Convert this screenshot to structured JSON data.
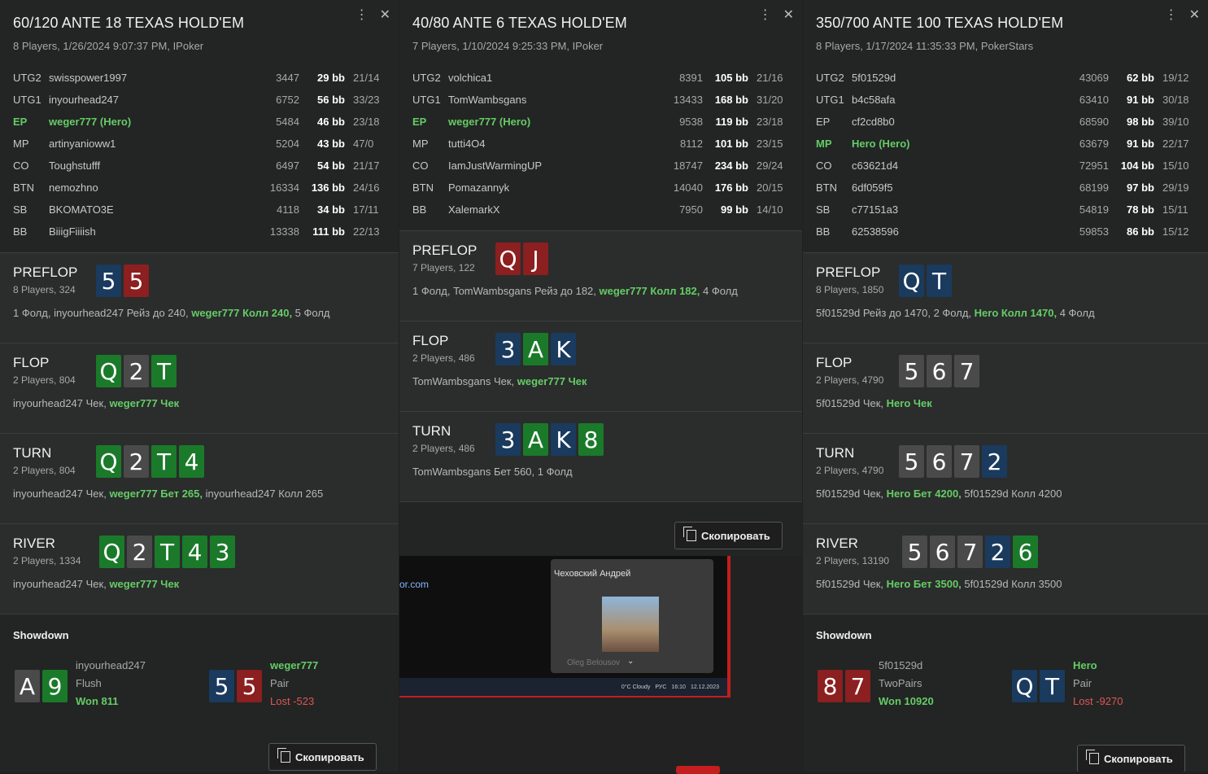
{
  "panels": [
    {
      "title": "60/120 ANTE 18 TEXAS HOLD'EM",
      "subtitle": "8 Players, 1/26/2024 9:07:37 PM, IPoker",
      "players": [
        {
          "pos": "UTG2",
          "name": "swisspower1997",
          "stack": "3447",
          "bb": "29 bb",
          "ratio": "21/14"
        },
        {
          "pos": "UTG1",
          "name": "inyourhead247",
          "stack": "6752",
          "bb": "56 bb",
          "ratio": "33/23"
        },
        {
          "pos": "EP",
          "name": "weger777 (Hero)",
          "stack": "5484",
          "bb": "46 bb",
          "ratio": "23/18",
          "hero": true
        },
        {
          "pos": "MP",
          "name": "artinyanioww1",
          "stack": "5204",
          "bb": "43 bb",
          "ratio": "47/0"
        },
        {
          "pos": "CO",
          "name": "Toughstufff",
          "stack": "6497",
          "bb": "54 bb",
          "ratio": "21/17"
        },
        {
          "pos": "BTN",
          "name": "nemozhno",
          "stack": "16334",
          "bb": "136 bb",
          "ratio": "24/16"
        },
        {
          "pos": "SB",
          "name": "BKOMATO3E",
          "stack": "4118",
          "bb": "34 bb",
          "ratio": "17/11"
        },
        {
          "pos": "BB",
          "name": "BiiigFiiiish",
          "stack": "13338",
          "bb": "111 bb",
          "ratio": "22/13"
        }
      ],
      "streets": [
        {
          "name": "PREFLOP",
          "info": "8 Players, 324",
          "cards": [
            {
              "r": "5",
              "c": "blue"
            },
            {
              "r": "5",
              "c": "red"
            }
          ],
          "pre": "1 Фолд, inyourhead247 Рейз до 240, ",
          "hero": "weger777 Колл 240,",
          "post": " 5 Фолд"
        },
        {
          "name": "FLOP",
          "info": "2 Players, 804",
          "cards": [
            {
              "r": "Q",
              "c": "green"
            },
            {
              "r": "2",
              "c": "grey"
            },
            {
              "r": "T",
              "c": "green"
            }
          ],
          "pre": "inyourhead247 Чек, ",
          "hero": "weger777 Чек",
          "post": ""
        },
        {
          "name": "TURN",
          "info": "2 Players, 804",
          "cards": [
            {
              "r": "Q",
              "c": "green"
            },
            {
              "r": "2",
              "c": "grey"
            },
            {
              "r": "T",
              "c": "green"
            },
            {
              "r": "4",
              "c": "green"
            }
          ],
          "pre": "inyourhead247 Чек, ",
          "hero": "weger777 Бет 265,",
          "post": " inyourhead247 Колл 265"
        },
        {
          "name": "RIVER",
          "info": "2 Players, 1334",
          "cards": [
            {
              "r": "Q",
              "c": "green"
            },
            {
              "r": "2",
              "c": "grey"
            },
            {
              "r": "T",
              "c": "green"
            },
            {
              "r": "4",
              "c": "green"
            },
            {
              "r": "3",
              "c": "green"
            }
          ],
          "pre": "inyourhead247 Чек, ",
          "hero": "weger777 Чек",
          "post": ""
        }
      ],
      "showdown": {
        "title": "Showdown",
        "hands": [
          {
            "cards": [
              {
                "r": "A",
                "c": "grey"
              },
              {
                "r": "9",
                "c": "green"
              }
            ],
            "name": "inyourhead247",
            "combo": "Flush",
            "result": "Won 811",
            "won": true,
            "hero": false
          },
          {
            "cards": [
              {
                "r": "5",
                "c": "blue"
              },
              {
                "r": "5",
                "c": "red"
              }
            ],
            "name": "weger777",
            "combo": "Pair",
            "result": "Lost -523",
            "won": false,
            "hero": true
          }
        ]
      },
      "copy_label": "Скопировать"
    },
    {
      "title": "40/80 ANTE 6 TEXAS HOLD'EM",
      "subtitle": "7 Players, 1/10/2024 9:25:33 PM, IPoker",
      "players": [
        {
          "pos": "UTG2",
          "name": "volchica1",
          "stack": "8391",
          "bb": "105 bb",
          "ratio": "21/16"
        },
        {
          "pos": "UTG1",
          "name": "TomWambsgans",
          "stack": "13433",
          "bb": "168 bb",
          "ratio": "31/20"
        },
        {
          "pos": "EP",
          "name": "weger777 (Hero)",
          "stack": "9538",
          "bb": "119 bb",
          "ratio": "23/18",
          "hero": true
        },
        {
          "pos": "MP",
          "name": "tutti4O4",
          "stack": "8112",
          "bb": "101 bb",
          "ratio": "23/15"
        },
        {
          "pos": "CO",
          "name": "IamJustWarmingUP",
          "stack": "18747",
          "bb": "234 bb",
          "ratio": "29/24"
        },
        {
          "pos": "BTN",
          "name": "Pomazannyk",
          "stack": "14040",
          "bb": "176 bb",
          "ratio": "20/15"
        },
        {
          "pos": "BB",
          "name": "XalemarkX",
          "stack": "7950",
          "bb": "99 bb",
          "ratio": "14/10"
        }
      ],
      "streets": [
        {
          "name": "PREFLOP",
          "info": "7 Players, 122",
          "cards": [
            {
              "r": "Q",
              "c": "red"
            },
            {
              "r": "J",
              "c": "red"
            }
          ],
          "pre": "1 Фолд, TomWambsgans Рейз до 182, ",
          "hero": "weger777 Колл 182,",
          "post": " 4 Фолд"
        },
        {
          "name": "FLOP",
          "info": "2 Players, 486",
          "cards": [
            {
              "r": "3",
              "c": "blue"
            },
            {
              "r": "A",
              "c": "green"
            },
            {
              "r": "K",
              "c": "blue"
            }
          ],
          "pre": "TomWambsgans Чек, ",
          "hero": "weger777 Чек",
          "post": ""
        },
        {
          "name": "TURN",
          "info": "2 Players, 486",
          "cards": [
            {
              "r": "3",
              "c": "blue"
            },
            {
              "r": "A",
              "c": "green"
            },
            {
              "r": "K",
              "c": "blue"
            },
            {
              "r": "8",
              "c": "green"
            }
          ],
          "pre": "TomWambsgans Бет 560, 1 Фолд",
          "hero": "",
          "post": ""
        }
      ],
      "copy_label": "Скопировать"
    },
    {
      "title": "350/700 ANTE 100 TEXAS HOLD'EM",
      "subtitle": "8 Players, 1/17/2024 11:35:33 PM, PokerStars",
      "players": [
        {
          "pos": "UTG2",
          "name": "5f01529d",
          "stack": "43069",
          "bb": "62 bb",
          "ratio": "19/12"
        },
        {
          "pos": "UTG1",
          "name": "b4c58afa",
          "stack": "63410",
          "bb": "91 bb",
          "ratio": "30/18"
        },
        {
          "pos": "EP",
          "name": "cf2cd8b0",
          "stack": "68590",
          "bb": "98 bb",
          "ratio": "39/10"
        },
        {
          "pos": "MP",
          "name": "Hero (Hero)",
          "stack": "63679",
          "bb": "91 bb",
          "ratio": "22/17",
          "hero": true
        },
        {
          "pos": "CO",
          "name": "c63621d4",
          "stack": "72951",
          "bb": "104 bb",
          "ratio": "15/10"
        },
        {
          "pos": "BTN",
          "name": "6df059f5",
          "stack": "68199",
          "bb": "97 bb",
          "ratio": "29/19"
        },
        {
          "pos": "SB",
          "name": "c77151a3",
          "stack": "54819",
          "bb": "78 bb",
          "ratio": "15/11"
        },
        {
          "pos": "BB",
          "name": "62538596",
          "stack": "59853",
          "bb": "86 bb",
          "ratio": "15/12"
        }
      ],
      "streets": [
        {
          "name": "PREFLOP",
          "info": "8 Players, 1850",
          "cards": [
            {
              "r": "Q",
              "c": "blue"
            },
            {
              "r": "T",
              "c": "blue"
            }
          ],
          "pre": "5f01529d Рейз до 1470, 2 Фолд, ",
          "hero": "Hero Колл 1470,",
          "post": " 4 Фолд"
        },
        {
          "name": "FLOP",
          "info": "2 Players, 4790",
          "cards": [
            {
              "r": "5",
              "c": "grey"
            },
            {
              "r": "6",
              "c": "grey"
            },
            {
              "r": "7",
              "c": "grey"
            }
          ],
          "pre": "5f01529d Чек, ",
          "hero": "Hero Чек",
          "post": ""
        },
        {
          "name": "TURN",
          "info": "2 Players, 4790",
          "cards": [
            {
              "r": "5",
              "c": "grey"
            },
            {
              "r": "6",
              "c": "grey"
            },
            {
              "r": "7",
              "c": "grey"
            },
            {
              "r": "2",
              "c": "blue"
            }
          ],
          "pre": "5f01529d Чек, ",
          "hero": "Hero Бет 4200,",
          "post": " 5f01529d Колл 4200"
        },
        {
          "name": "RIVER",
          "info": "2 Players, 13190",
          "cards": [
            {
              "r": "5",
              "c": "grey"
            },
            {
              "r": "6",
              "c": "grey"
            },
            {
              "r": "7",
              "c": "grey"
            },
            {
              "r": "2",
              "c": "blue"
            },
            {
              "r": "6",
              "c": "green"
            }
          ],
          "pre": "5f01529d Чек, ",
          "hero": "Hero Бет 3500,",
          "post": " 5f01529d Колл 3500"
        }
      ],
      "showdown": {
        "title": "Showdown",
        "hands": [
          {
            "cards": [
              {
                "r": "8",
                "c": "red"
              },
              {
                "r": "7",
                "c": "red"
              }
            ],
            "name": "5f01529d",
            "combo": "TwoPairs",
            "result": "Won 10920",
            "won": true,
            "hero": false
          },
          {
            "cards": [
              {
                "r": "Q",
                "c": "blue"
              },
              {
                "r": "T",
                "c": "blue"
              }
            ],
            "name": "Hero",
            "combo": "Pair",
            "result": "Lost -9270",
            "won": false,
            "hero": true
          }
        ]
      },
      "copy_label": "Скопировать"
    }
  ],
  "background": {
    "url_text": "or.com",
    "call_name": "Чеховский Андрей",
    "caller_label": "Oleg Belousov",
    "weather": "0°C Cloudy",
    "lang": "РУС",
    "time": "16:10",
    "date": "12.12.2023"
  },
  "colors": {
    "hero": "#66cc66",
    "lost": "#e05555",
    "card_blue": "#1a3a5e",
    "card_red": "#8c1f1f",
    "card_green": "#1a7a2a",
    "card_grey": "#4a4a4a"
  }
}
